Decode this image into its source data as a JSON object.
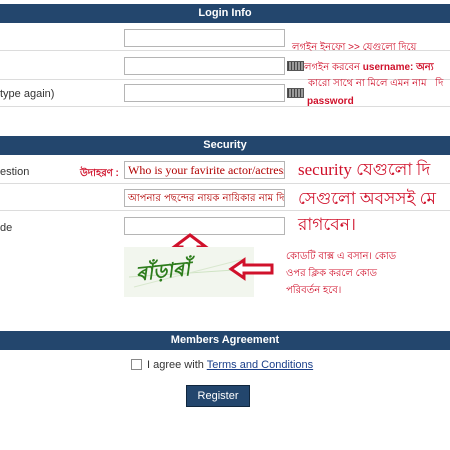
{
  "login_info": {
    "header": "Login Info",
    "row3_label": "type again)",
    "note_line1": "লগইন ইনফো >> যেগুলো দিয়ে",
    "note_line2_a": "লগইন করবেন",
    "note_line2_b": "username: অন্য",
    "note_line3": "কারো সাথে না মিলে এমন নাম",
    "note_line3_tail": "দি",
    "note_line4": "password"
  },
  "security": {
    "header": "Security",
    "question_label": "estion",
    "example_label": "উদাহরণ :",
    "question_value": "Who is your favirite actor/actress",
    "answer_value": "আপনার পছন্দের নায়ক নায়িকার নাম দিন",
    "code_label": "de",
    "big_note_line1": "security যেগুলো দি",
    "big_note_line2": "সেগুলো অবসসই মে",
    "big_note_line3": "রাগবেন।",
    "code_note_line1": "কোডটি বাক্স এ বসান। কোড",
    "code_note_line2": "ওপর ক্লিক করলে কোড",
    "code_note_line3": "পরিবর্তন হবে।",
    "captcha_text": "ৰাঁড়াৰাঁ"
  },
  "agreement": {
    "header": "Members Agreement",
    "agree_prefix": "I agree with",
    "terms_link": "Terms and Conditions",
    "register_label": "Register"
  },
  "colors": {
    "header_bg": "#23466d",
    "note_red": "#d0112b"
  },
  "icons": [
    "keyboard-icon",
    "up-arrow-icon",
    "left-arrow-icon"
  ]
}
